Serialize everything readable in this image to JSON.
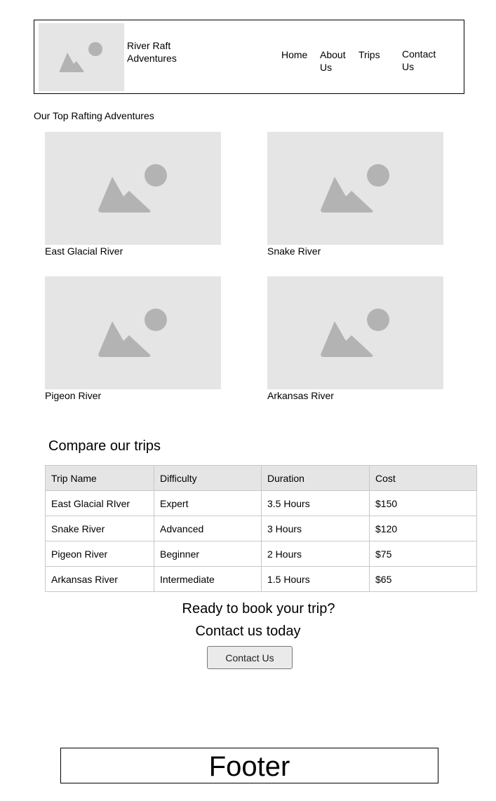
{
  "header": {
    "brand": "River Raft Adventures",
    "nav": [
      {
        "label": "Home"
      },
      {
        "label": "About Us"
      },
      {
        "label": "Trips"
      },
      {
        "label": "Contact Us"
      }
    ]
  },
  "top_adventures": {
    "title": "Our Top Rafting Adventures",
    "cards": [
      {
        "label": "East Glacial River"
      },
      {
        "label": "Snake River"
      },
      {
        "label": "Pigeon River"
      },
      {
        "label": "Arkansas River"
      }
    ]
  },
  "compare": {
    "title": "Compare our trips",
    "columns": [
      "Trip Name",
      "Difficulty",
      "Duration",
      "Cost"
    ],
    "rows": [
      [
        "East Glacial RIver",
        "Expert",
        "3.5 Hours",
        "$150"
      ],
      [
        "Snake River",
        "Advanced",
        "3 Hours",
        "$120"
      ],
      [
        "Pigeon River",
        "Beginner",
        "2 Hours",
        "$75"
      ],
      [
        "Arkansas River",
        "Intermediate",
        "1.5 Hours",
        "$65"
      ]
    ]
  },
  "cta": {
    "line1": "Ready to book your trip?",
    "line2": "Contact us today",
    "button_label": "Contact Us"
  },
  "footer": {
    "label": "Footer"
  },
  "colors": {
    "placeholder_bg": "#e5e5e5",
    "placeholder_shape": "#b3b3b3",
    "table_header_bg": "#e5e5e5"
  },
  "icons": {
    "image_placeholder": "image-placeholder-icon"
  }
}
